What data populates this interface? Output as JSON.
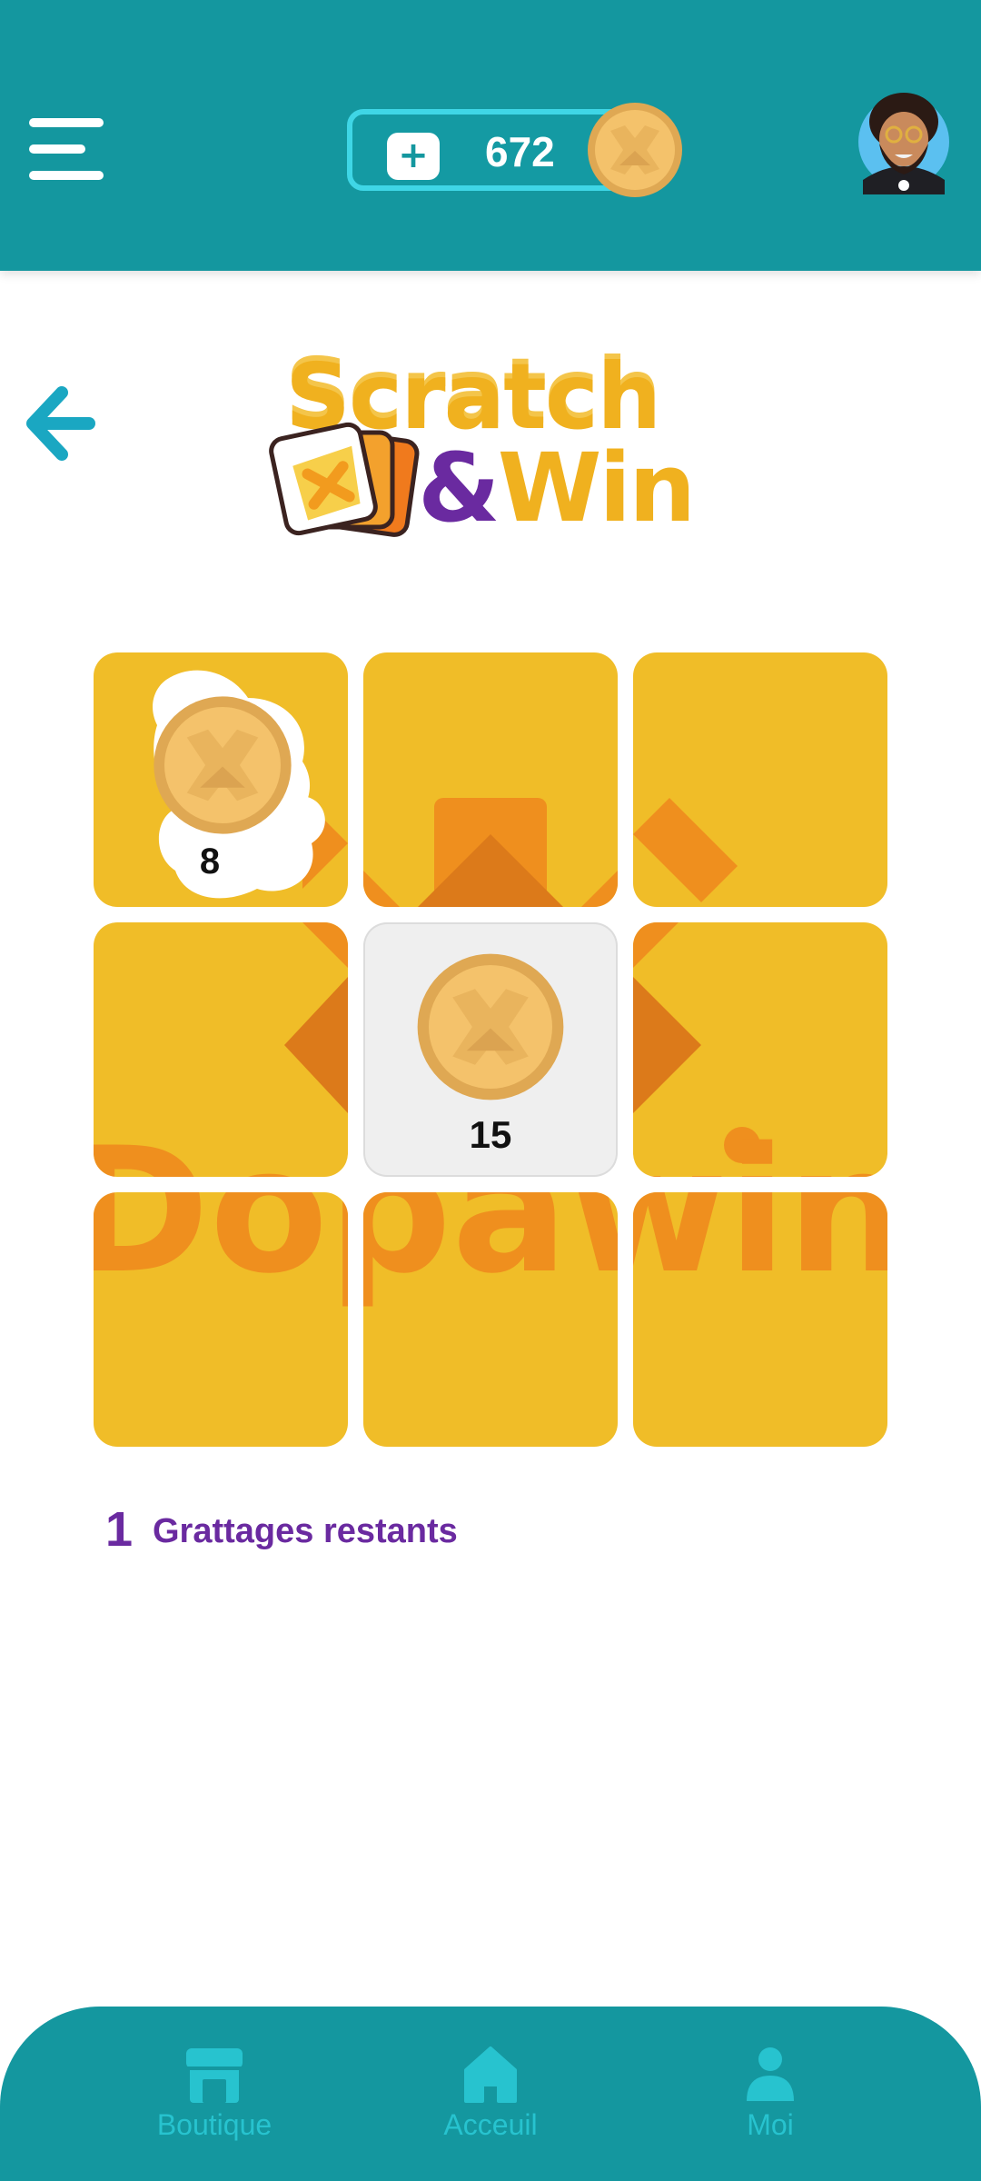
{
  "header": {
    "coin_balance": "672",
    "add_label": "+"
  },
  "logo": {
    "line1": "Scratch",
    "amp": "&",
    "line2": "Win"
  },
  "grid": {
    "tiles": [
      {
        "state": "partially-scratched",
        "prize": "8"
      },
      {
        "state": "hidden",
        "prize": ""
      },
      {
        "state": "hidden",
        "prize": ""
      },
      {
        "state": "hidden",
        "prize": ""
      },
      {
        "state": "revealed",
        "prize": "15"
      },
      {
        "state": "hidden",
        "prize": ""
      },
      {
        "state": "hidden",
        "prize": ""
      },
      {
        "state": "hidden",
        "prize": ""
      },
      {
        "state": "hidden",
        "prize": ""
      }
    ],
    "watermark": "Dopawin"
  },
  "remaining": {
    "count": "1",
    "label": "Grattages restants"
  },
  "nav": {
    "items": [
      {
        "label": "Boutique",
        "icon": "shop-icon"
      },
      {
        "label": "Acceuil",
        "icon": "home-icon"
      },
      {
        "label": "Moi",
        "icon": "user-icon"
      }
    ]
  },
  "colors": {
    "header": "#14979f",
    "tile": "#f0bd28",
    "tile_art": "#ef8f1e",
    "purple": "#6a2aa0",
    "coin": "#f4c26b"
  }
}
